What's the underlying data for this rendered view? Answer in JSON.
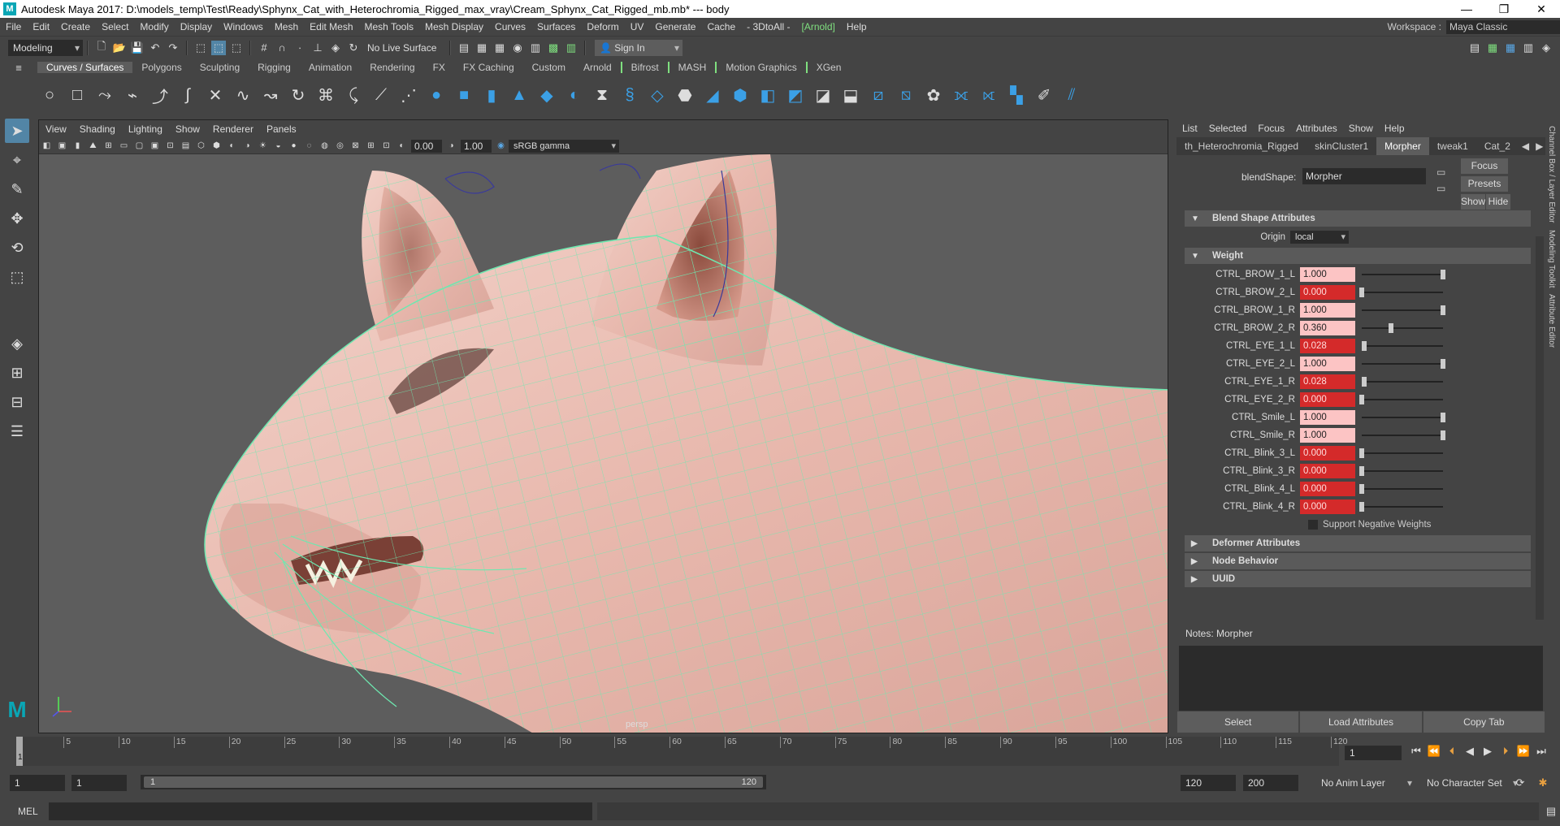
{
  "titlebar": {
    "title": "Autodesk Maya 2017: D:\\models_temp\\Test\\Ready\\Sphynx_Cat_with_Heterochromia_Rigged_max_vray\\Cream_Sphynx_Cat_Rigged_mb.mb*  ---  body"
  },
  "menubar": {
    "items": [
      "File",
      "Edit",
      "Create",
      "Select",
      "Modify",
      "Display",
      "Windows",
      "Mesh",
      "Edit Mesh",
      "Mesh Tools",
      "Mesh Display",
      "Curves",
      "Surfaces",
      "Deform",
      "UV",
      "Generate",
      "Cache",
      "- 3DtoAll -",
      "[Arnold]",
      "Help"
    ],
    "workspace_label": "Workspace :",
    "workspace_value": "Maya Classic"
  },
  "statusline": {
    "menuset": "Modeling",
    "live_surface": "No Live Surface",
    "sign_in": "Sign In"
  },
  "shelf": {
    "tabs": [
      "Curves / Surfaces",
      "Polygons",
      "Sculpting",
      "Rigging",
      "Animation",
      "Rendering",
      "FX",
      "FX Caching",
      "Custom",
      "Arnold",
      "Bifrost",
      "MASH",
      "Motion Graphics",
      "XGen"
    ],
    "active_tab": "Curves / Surfaces"
  },
  "viewport": {
    "menus": [
      "View",
      "Shading",
      "Lighting",
      "Show",
      "Renderer",
      "Panels"
    ],
    "exposure": "0.00",
    "gamma": "1.00",
    "colorspace": "sRGB gamma",
    "camera_label": "persp"
  },
  "attribute_editor": {
    "menus": [
      "List",
      "Selected",
      "Focus",
      "Attributes",
      "Show",
      "Help"
    ],
    "tabs": [
      "th_Heterochromia_Rigged",
      "skinCluster1",
      "Morpher",
      "tweak1",
      "Cat_2"
    ],
    "active_tab": "Morpher",
    "node_type_label": "blendShape:",
    "node_name": "Morpher",
    "focus_btn": "Focus",
    "presets_btn": "Presets",
    "show_btn": "Show",
    "hide_btn": "Hide",
    "section_blend": "Blend Shape Attributes",
    "origin_label": "Origin",
    "origin_value": "local",
    "section_weight": "Weight",
    "weights": [
      {
        "name": "CTRL_BROW_1_L",
        "value": "1.000",
        "level": 1.0
      },
      {
        "name": "CTRL_BROW_2_L",
        "value": "0.000",
        "level": 0.0
      },
      {
        "name": "CTRL_BROW_1_R",
        "value": "1.000",
        "level": 1.0
      },
      {
        "name": "CTRL_BROW_2_R",
        "value": "0.360",
        "level": 0.36
      },
      {
        "name": "CTRL_EYE_1_L",
        "value": "0.028",
        "level": 0.028
      },
      {
        "name": "CTRL_EYE_2_L",
        "value": "1.000",
        "level": 1.0
      },
      {
        "name": "CTRL_EYE_1_R",
        "value": "0.028",
        "level": 0.028
      },
      {
        "name": "CTRL_EYE_2_R",
        "value": "0.000",
        "level": 0.0
      },
      {
        "name": "CTRL_Smile_L",
        "value": "1.000",
        "level": 1.0
      },
      {
        "name": "CTRL_Smile_R",
        "value": "1.000",
        "level": 1.0
      },
      {
        "name": "CTRL_Blink_3_L",
        "value": "0.000",
        "level": 0.0
      },
      {
        "name": "CTRL_Blink_3_R",
        "value": "0.000",
        "level": 0.0
      },
      {
        "name": "CTRL_Blink_4_L",
        "value": "0.000",
        "level": 0.0
      },
      {
        "name": "CTRL_Blink_4_R",
        "value": "0.000",
        "level": 0.0
      }
    ],
    "support_negative": "Support Negative Weights",
    "collapsed_sections": [
      "Deformer Attributes",
      "Node Behavior",
      "UUID"
    ],
    "notes_label": "Notes:  Morpher",
    "bottom_buttons": [
      "Select",
      "Load Attributes",
      "Copy Tab"
    ]
  },
  "right_strip": [
    "Channel Box / Layer Editor",
    "Modeling Toolkit",
    "Attribute Editor"
  ],
  "timeslider": {
    "ticks": [
      "5",
      "10",
      "15",
      "20",
      "25",
      "30",
      "35",
      "40",
      "45",
      "50",
      "55",
      "60",
      "65",
      "70",
      "75",
      "80",
      "85",
      "90",
      "95",
      "100",
      "105",
      "110",
      "115",
      "120"
    ],
    "current_frame": "1",
    "start_marker": "1"
  },
  "range": {
    "start": "1",
    "playback_start": "1",
    "bar_start": "1",
    "bar_end": "120",
    "playback_end": "120",
    "end": "200",
    "anim_layer": "No Anim Layer",
    "char_set": "No Character Set"
  },
  "cmdline": {
    "label": "MEL"
  }
}
